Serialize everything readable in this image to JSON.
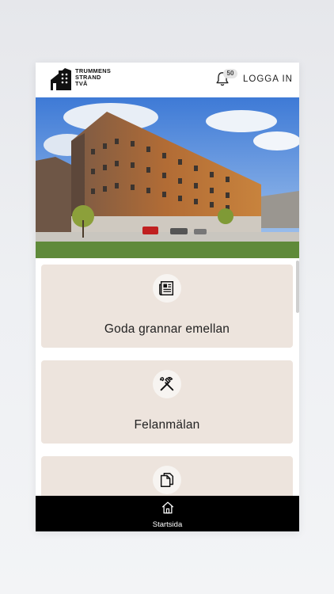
{
  "header": {
    "logo_lines": [
      "TRUMMENS",
      "STRAND",
      "TVÅ"
    ],
    "notification_count": "50",
    "login_label": "LOGGA IN"
  },
  "hero": {
    "image": "brick-apartment-building-photo"
  },
  "cards": [
    {
      "icon": "newspaper-icon",
      "title": "Goda grannar emellan"
    },
    {
      "icon": "tools-icon",
      "title": "Felanmälan"
    },
    {
      "icon": "documents-icon",
      "title": ""
    }
  ],
  "tabbar": {
    "items": [
      {
        "icon": "home-icon",
        "label": "Startsida"
      }
    ]
  },
  "colors": {
    "card_bg": "#ede4dd",
    "tabbar_bg": "#000000",
    "accent_text": "#222222"
  }
}
